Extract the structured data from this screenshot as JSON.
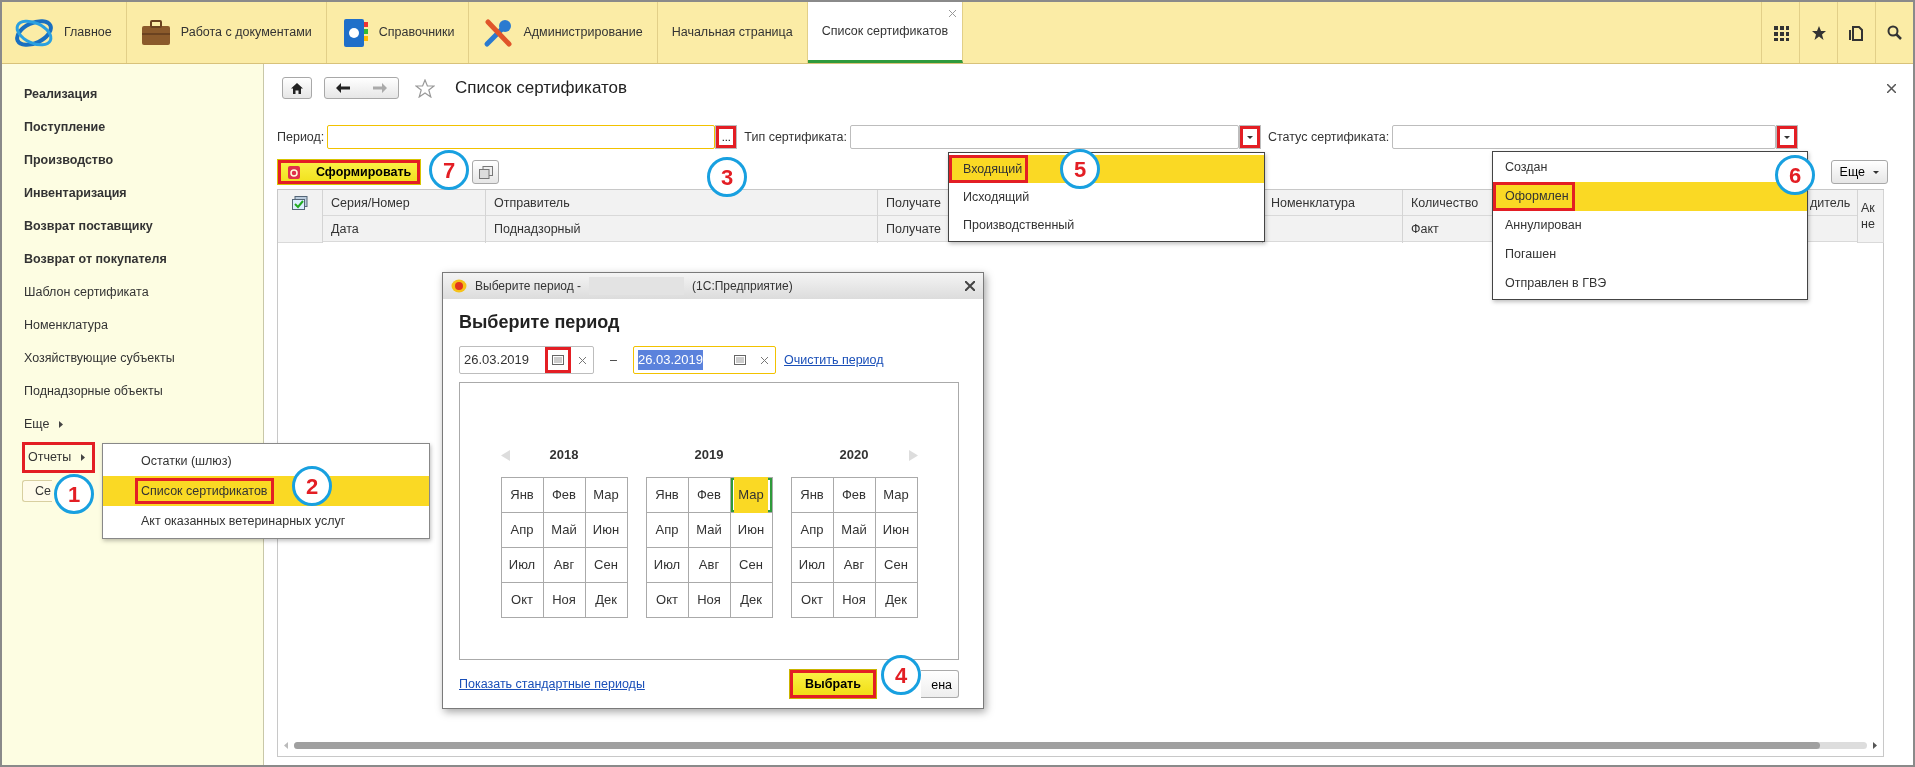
{
  "top_bar": {
    "sections": [
      {
        "label": "Главное"
      },
      {
        "label": "Работа с документами"
      },
      {
        "label": "Справочники"
      },
      {
        "label": "Администрирование"
      }
    ],
    "tabs": [
      {
        "label": "Начальная страница",
        "selected": false
      },
      {
        "label": "Список сертификатов",
        "selected": true
      }
    ]
  },
  "sidebar": {
    "items": [
      {
        "label": "Реализация",
        "kind": "section",
        "highlighted": false
      },
      {
        "label": "Поступление",
        "kind": "section",
        "highlighted": false
      },
      {
        "label": "Производство",
        "kind": "section",
        "highlighted": false
      },
      {
        "label": "Инвентаризация",
        "kind": "section",
        "highlighted": false
      },
      {
        "label": "Возврат поставщику",
        "kind": "section",
        "highlighted": false
      },
      {
        "label": "Возврат от покупателя",
        "kind": "section",
        "highlighted": false
      },
      {
        "label": "Шаблон сертификата",
        "kind": "link",
        "highlighted": false
      },
      {
        "label": "Номенклатура",
        "kind": "link",
        "highlighted": false
      },
      {
        "label": "Хозяйствующие субъекты",
        "kind": "link",
        "highlighted": false
      },
      {
        "label": "Поднадзорные объекты",
        "kind": "link",
        "highlighted": false
      },
      {
        "label": "Еще",
        "kind": "submenu",
        "highlighted": false
      },
      {
        "label": "Отчеты",
        "kind": "submenu",
        "highlighted": true
      },
      {
        "label": "Се",
        "kind": "button",
        "highlighted": false
      }
    ]
  },
  "reports_menu": {
    "items": [
      {
        "label": "Остатки (шлюз)",
        "selected": false,
        "highlighted": false
      },
      {
        "label": "Список сертификатов",
        "selected": true,
        "highlighted": true
      },
      {
        "label": "Акт оказанных ветеринарных услуг",
        "selected": false,
        "highlighted": false
      }
    ]
  },
  "page": {
    "title": "Список сертификатов",
    "filters": [
      {
        "label": "Период:",
        "kind": "choice",
        "button": "...",
        "button_highlighted": true,
        "focused": true
      },
      {
        "label": "Тип сертификата:",
        "kind": "dropdown",
        "button_highlighted": true,
        "focused": false
      },
      {
        "label": "Статус сертификата:",
        "kind": "dropdown",
        "button_highlighted": true,
        "focused": false
      }
    ],
    "generate_button": {
      "label": "Сформировать",
      "highlighted": true
    },
    "more_button": "Еще"
  },
  "table": {
    "columns": [
      {
        "kind": "icon"
      },
      {
        "kind": "pair",
        "top": "Серия/Номер",
        "bottom": "Дата"
      },
      {
        "kind": "pair",
        "top": "Отправитель",
        "bottom": "Поднадзорный"
      },
      {
        "kind": "pair",
        "top": "Получате",
        "bottom": "Получате"
      },
      {
        "kind": "pair",
        "top": "Номенклатура"
      },
      {
        "kind": "pair",
        "top": "Количество",
        "bottom": "Факт"
      },
      {
        "kind": "pair",
        "top": "дитель"
      },
      {
        "kind": "tall",
        "top": "Ак не"
      }
    ]
  },
  "type_dropdown": {
    "options": [
      {
        "label": "Входящий",
        "selected": true,
        "highlighted": true
      },
      {
        "label": "Исходящий",
        "selected": false,
        "highlighted": false
      },
      {
        "label": "Производственный",
        "selected": false,
        "highlighted": false
      }
    ]
  },
  "status_dropdown": {
    "options": [
      {
        "label": "Создан",
        "selected": false,
        "highlighted": false
      },
      {
        "label": "Оформлен",
        "selected": true,
        "highlighted": true
      },
      {
        "label": "Аннулирован",
        "selected": false,
        "highlighted": false
      },
      {
        "label": "Погашен",
        "selected": false,
        "highlighted": false
      },
      {
        "label": "Отправлен в ГВЭ",
        "selected": false,
        "highlighted": false
      }
    ]
  },
  "period_dialog": {
    "window_title": "Выберите период -",
    "window_app": "(1С:Предприятие)",
    "heading": "Выберите период",
    "start_date": "26.03.2019",
    "start_calendar_highlighted": true,
    "date_separator": "–",
    "end_date": "26.03.2019",
    "end_focused": true,
    "clear_link": "Очистить период",
    "years": [
      {
        "year": "2018",
        "months": [
          {
            "label": "Янв",
            "selected": false
          },
          {
            "label": "Фев",
            "selected": false
          },
          {
            "label": "Мар",
            "selected": false
          },
          {
            "label": "Апр",
            "selected": false
          },
          {
            "label": "Май",
            "selected": false
          },
          {
            "label": "Июн",
            "selected": false
          },
          {
            "label": "Июл",
            "selected": false
          },
          {
            "label": "Авг",
            "selected": false
          },
          {
            "label": "Сен",
            "selected": false
          },
          {
            "label": "Окт",
            "selected": false
          },
          {
            "label": "Ноя",
            "selected": false
          },
          {
            "label": "Дек",
            "selected": false
          }
        ]
      },
      {
        "year": "2019",
        "months": [
          {
            "label": "Янв",
            "selected": false
          },
          {
            "label": "Фев",
            "selected": false
          },
          {
            "label": "Мар",
            "selected": true
          },
          {
            "label": "Апр",
            "selected": false
          },
          {
            "label": "Май",
            "selected": false
          },
          {
            "label": "Июн",
            "selected": false
          },
          {
            "label": "Июл",
            "selected": false
          },
          {
            "label": "Авг",
            "selected": false
          },
          {
            "label": "Сен",
            "selected": false
          },
          {
            "label": "Окт",
            "selected": false
          },
          {
            "label": "Ноя",
            "selected": false
          },
          {
            "label": "Дек",
            "selected": false
          }
        ]
      },
      {
        "year": "2020",
        "months": [
          {
            "label": "Янв",
            "selected": false
          },
          {
            "label": "Фев",
            "selected": false
          },
          {
            "label": "Мар",
            "selected": false
          },
          {
            "label": "Апр",
            "selected": false
          },
          {
            "label": "Май",
            "selected": false
          },
          {
            "label": "Июн",
            "selected": false
          },
          {
            "label": "Июл",
            "selected": false
          },
          {
            "label": "Авг",
            "selected": false
          },
          {
            "label": "Сен",
            "selected": false
          },
          {
            "label": "Окт",
            "selected": false
          },
          {
            "label": "Ноя",
            "selected": false
          },
          {
            "label": "Дек",
            "selected": false
          }
        ]
      }
    ],
    "standard_link": "Показать стандартные периоды",
    "ok_button": {
      "label": "Выбрать",
      "highlighted": true
    },
    "cancel_button": "ена"
  },
  "step_markers": [
    {
      "number": "7"
    },
    {
      "number": "3"
    },
    {
      "number": "5"
    },
    {
      "number": "6"
    },
    {
      "number": "1"
    },
    {
      "number": "2"
    },
    {
      "number": "4"
    }
  ]
}
